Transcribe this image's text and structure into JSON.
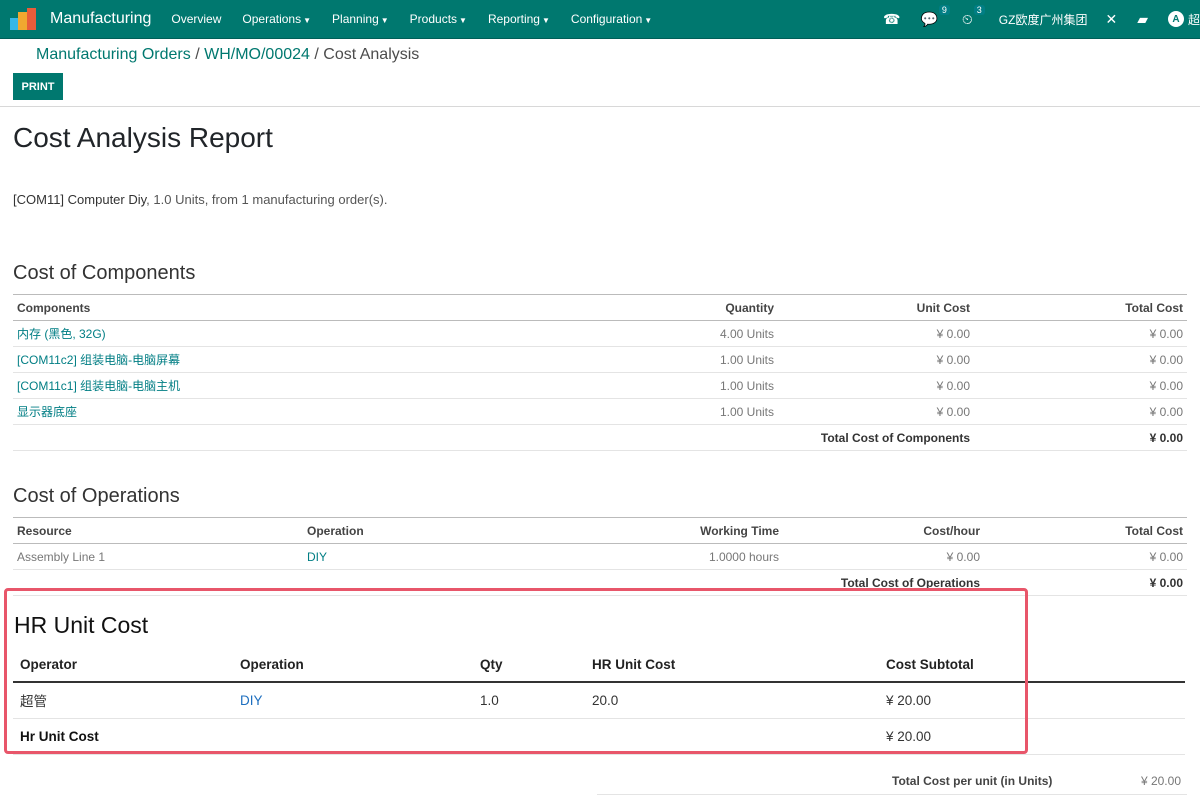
{
  "navbar": {
    "brand": "Manufacturing",
    "menu": [
      {
        "label": "Overview",
        "dropdown": false
      },
      {
        "label": "Operations",
        "dropdown": true
      },
      {
        "label": "Planning",
        "dropdown": true
      },
      {
        "label": "Products",
        "dropdown": true
      },
      {
        "label": "Reporting",
        "dropdown": true
      },
      {
        "label": "Configuration",
        "dropdown": true
      }
    ],
    "messages_count": "9",
    "activities_count": "3",
    "company": "GZ欧度广州集团",
    "avatar_letter": "A",
    "user": "超"
  },
  "breadcrumb": {
    "item1": "Manufacturing Orders",
    "item2": "WH/MO/00024",
    "current": "Cost Analysis",
    "separator": "/"
  },
  "print_button": "PRINT",
  "report": {
    "title": "Cost Analysis Report",
    "product": "[COM11] Computer Diy",
    "summary": ", 1.0 Units, from 1 manufacturing order(s)."
  },
  "components": {
    "heading": "Cost of Components",
    "columns": [
      "Components",
      "Quantity",
      "Unit Cost",
      "Total Cost"
    ],
    "rows": [
      {
        "name": "内存 (黑色, 32G)",
        "qty": "4.00 Units",
        "unit_cost": "¥ 0.00",
        "total": "¥ 0.00"
      },
      {
        "name": "[COM11c2] 组装电脑-电脑屏幕",
        "qty": "1.00 Units",
        "unit_cost": "¥ 0.00",
        "total": "¥ 0.00"
      },
      {
        "name": "[COM11c1] 组装电脑-电脑主机",
        "qty": "1.00 Units",
        "unit_cost": "¥ 0.00",
        "total": "¥ 0.00"
      },
      {
        "name": "显示器底座",
        "qty": "1.00 Units",
        "unit_cost": "¥ 0.00",
        "total": "¥ 0.00"
      }
    ],
    "total_label": "Total Cost of Components",
    "total_value": "¥ 0.00"
  },
  "operations": {
    "heading": "Cost of Operations",
    "columns": [
      "Resource",
      "Operation",
      "Working Time",
      "Cost/hour",
      "Total Cost"
    ],
    "rows": [
      {
        "resource": "Assembly Line 1",
        "operation": "DIY",
        "time": "1.0000 hours",
        "cost_hour": "¥ 0.00",
        "total": "¥ 0.00"
      }
    ],
    "total_label": "Total Cost of Operations",
    "total_value": "¥ 0.00"
  },
  "hr": {
    "heading": "HR Unit Cost",
    "columns": [
      "Operator",
      "Operation",
      "Qty",
      "HR Unit Cost",
      "Cost Subtotal"
    ],
    "rows": [
      {
        "operator": "超管",
        "operation": "DIY",
        "qty": "1.0",
        "unit_cost": "20.0",
        "subtotal": "¥ 20.00"
      }
    ],
    "total_label": "Hr Unit Cost",
    "total_value": "¥ 20.00"
  },
  "grand_total": {
    "label": "Total Cost per unit (in Units)",
    "value": "¥ 20.00"
  },
  "colors": {
    "navbar": "#00786f",
    "link": "#017e84",
    "highlight": "#e8566a"
  }
}
